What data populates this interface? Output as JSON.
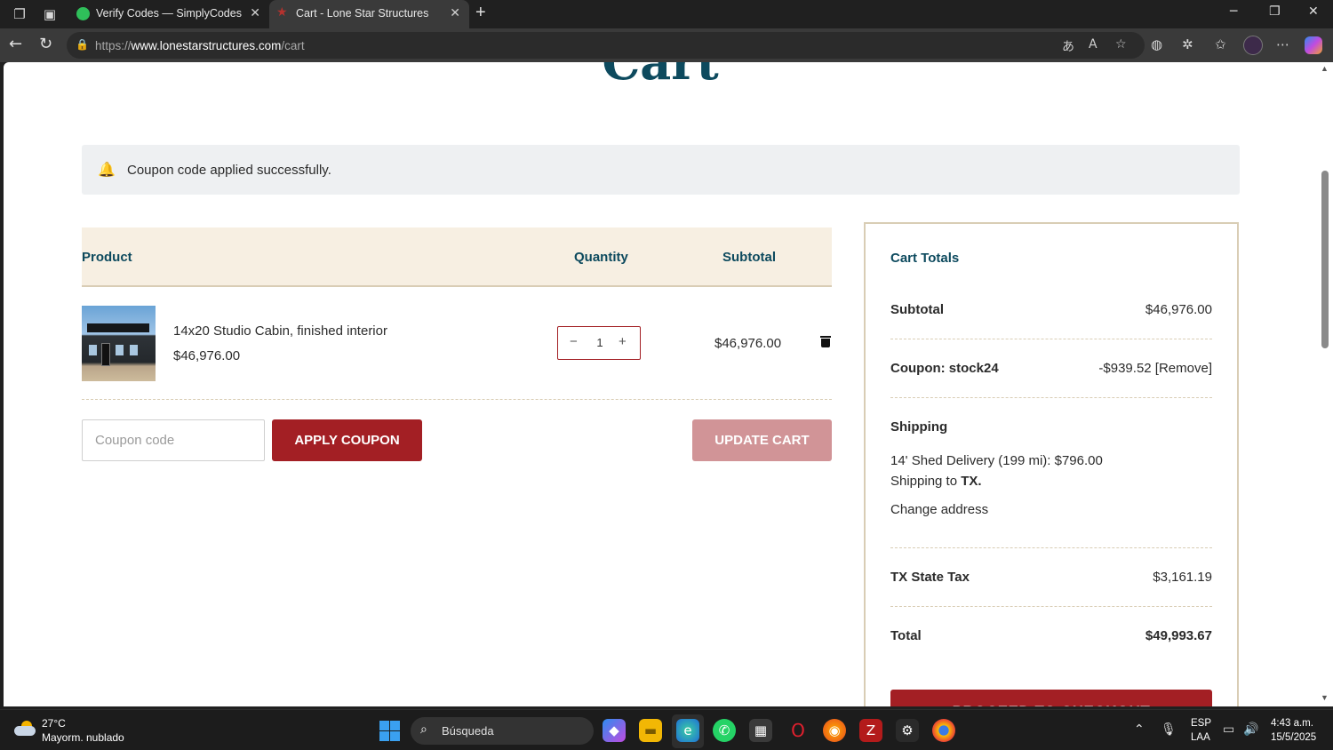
{
  "browser": {
    "tabs": [
      {
        "title": "Verify Codes — SimplyCodes",
        "icon": "simplycodes-check-icon",
        "active": false
      },
      {
        "title": "Cart - Lone Star Structures",
        "icon": "lone-star-icon",
        "active": true
      }
    ],
    "url_scheme": "https://",
    "url_host": "www.lonestarstructures.com",
    "url_path": "/cart"
  },
  "page": {
    "title": "Cart",
    "notice": "Coupon code applied successfully."
  },
  "cart": {
    "columns": {
      "product": "Product",
      "quantity": "Quantity",
      "subtotal": "Subtotal"
    },
    "items": [
      {
        "name": "14x20 Studio Cabin, finished interior",
        "price": "$46,976.00",
        "quantity": "1",
        "subtotal": "$46,976.00"
      }
    ],
    "coupon_placeholder": "Coupon code",
    "apply_coupon_label": "APPLY COUPON",
    "update_cart_label": "UPDATE CART"
  },
  "totals": {
    "title": "Cart Totals",
    "subtotal_label": "Subtotal",
    "subtotal_value": "$46,976.00",
    "coupon_label": "Coupon: stock24",
    "coupon_value": "-$939.52",
    "coupon_remove": "[Remove]",
    "shipping_label": "Shipping",
    "shipping_method": "14' Shed Delivery (199 mi): $796.00",
    "shipping_to_prefix": "Shipping to ",
    "shipping_to_state": "TX.",
    "change_address": "Change address",
    "tax_label": "TX State Tax",
    "tax_value": "$3,161.19",
    "total_label": "Total",
    "total_value": "$49,993.67",
    "checkout_label": "PROCEED TO CHECKOUT"
  },
  "taskbar": {
    "temperature": "27°C",
    "weather": "Mayorm. nublado",
    "search_label": "Búsqueda",
    "lang_line1": "ESP",
    "lang_line2": "LAA",
    "time": "4:43 a.m.",
    "date": "15/5/2025"
  },
  "colors": {
    "brand_red": "#a31f24",
    "brand_teal": "#0d4a5e",
    "table_header_bg": "#f7efe2"
  }
}
